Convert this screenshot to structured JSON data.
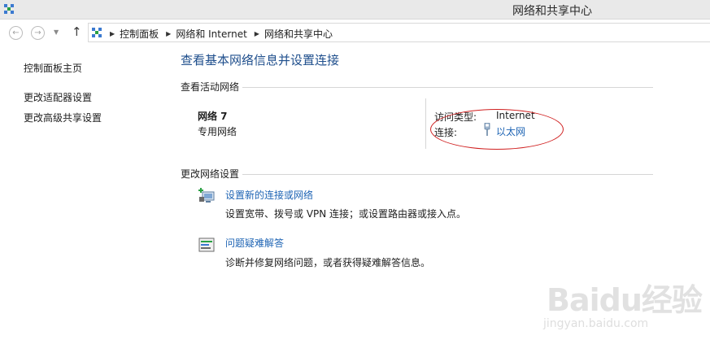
{
  "window": {
    "title": "网络和共享中心"
  },
  "address": {
    "breadcrumbs": [
      "控制面板",
      "网络和 Internet",
      "网络和共享中心"
    ]
  },
  "sidebar": {
    "items": [
      {
        "label": "控制面板主页"
      },
      {
        "label": "更改适配器设置"
      },
      {
        "label": "更改高级共享设置"
      }
    ]
  },
  "main": {
    "title": "查看基本网络信息并设置连接",
    "active_section": "查看活动网络",
    "network": {
      "name": "网络  7",
      "type": "专用网络",
      "access_label": "访问类型:",
      "access_value": "Internet",
      "connection_label": "连接:",
      "connection_value": "以太网"
    },
    "change_section": "更改网络设置",
    "tasks": [
      {
        "icon": "new-connection-icon",
        "link": "设置新的连接或网络",
        "desc": "设置宽带、拨号或 VPN 连接；或设置路由器或接入点。"
      },
      {
        "icon": "troubleshoot-icon",
        "link": "问题疑难解答",
        "desc": "诊断并修复网络问题，或者获得疑难解答信息。"
      }
    ]
  },
  "watermark": {
    "brand": "Baidu经验",
    "sub": "jingyan.baidu.com"
  },
  "colors": {
    "link": "#1e64b4",
    "title": "#1e4e8c",
    "highlight": "#d02020"
  }
}
